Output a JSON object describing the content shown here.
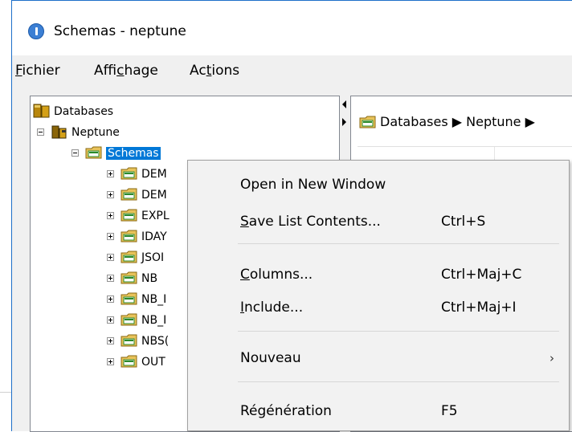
{
  "window": {
    "title": "Schemas - neptune"
  },
  "menubar": {
    "items": [
      {
        "pre": "",
        "key": "F",
        "post": "ichier"
      },
      {
        "pre": "Affi",
        "key": "c",
        "post": "hage"
      },
      {
        "pre": "Ac",
        "key": "t",
        "post": "ions"
      }
    ]
  },
  "tree": {
    "root": "Databases",
    "server": "Neptune",
    "schemas": "Schemas",
    "children": [
      "DEM",
      "DEM",
      "EXPL",
      "IDAY",
      "JSOI",
      "NB",
      "NB_I",
      "NB_I",
      "NBS(",
      "OUT"
    ]
  },
  "breadcrumb": {
    "text": "Databases ▶ Neptune ▶"
  },
  "context_menu": {
    "items": [
      {
        "label": "Open in New Window",
        "underline": "",
        "rest": "",
        "shortcut": ""
      },
      {
        "label": "",
        "underline": "S",
        "rest": "ave List Contents...",
        "shortcut": "Ctrl+S"
      },
      {
        "label": "",
        "underline": "C",
        "rest": "olumns...",
        "shortcut": "Ctrl+Maj+C"
      },
      {
        "label": "",
        "underline": "I",
        "rest": "nclude...",
        "shortcut": "Ctrl+Maj+I"
      },
      {
        "label": "Nouveau",
        "underline": "",
        "rest": "",
        "shortcut": "",
        "submenu_arrow": "›"
      },
      {
        "label": "Régénération",
        "underline": "",
        "rest": "",
        "shortcut": "F5"
      }
    ]
  },
  "colors": {
    "selection": "#0078d7",
    "window_border": "#1e6fc9"
  }
}
